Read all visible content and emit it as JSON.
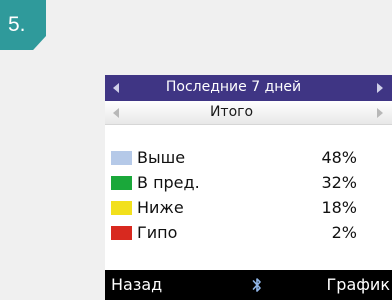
{
  "step_badge": "5.",
  "header": {
    "title": "Последние 7 дней"
  },
  "subheader": {
    "title": "Итого"
  },
  "legend": [
    {
      "label": "Выше",
      "value": "48%",
      "color": "#b5c9e8"
    },
    {
      "label": "В пред.",
      "value": "32%",
      "color": "#1aa83a"
    },
    {
      "label": "Ниже",
      "value": "18%",
      "color": "#f2e01c"
    },
    {
      "label": "Гипо",
      "value": "2%",
      "color": "#d8291f"
    }
  ],
  "footer": {
    "back_label": "Назад",
    "graph_label": "График",
    "center_icon": "bluetooth-icon"
  },
  "colors": {
    "header_bg": "#3f3584",
    "badge_bg": "#2f9a9b",
    "footer_bg": "#000000"
  }
}
